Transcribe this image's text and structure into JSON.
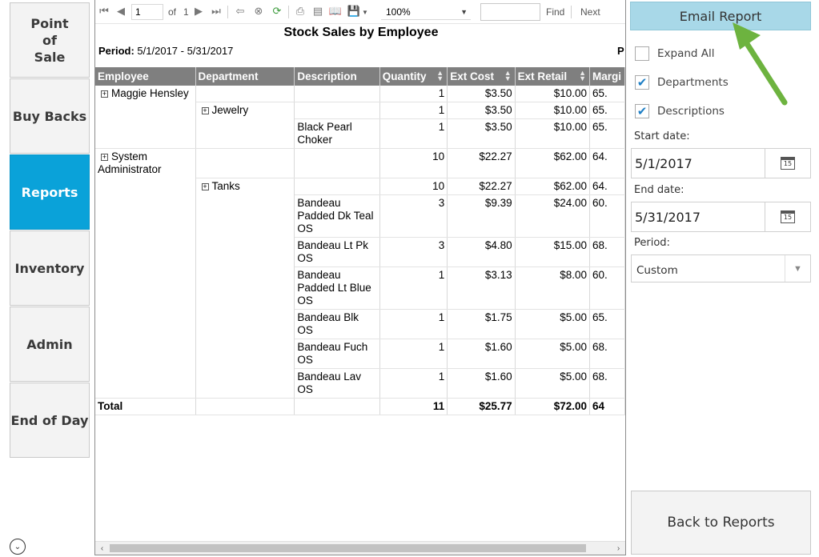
{
  "nav": {
    "items": [
      {
        "label": "Point\nof\nSale",
        "active": false
      },
      {
        "label": "Buy Backs",
        "active": false
      },
      {
        "label": "Reports",
        "active": true
      },
      {
        "label": "Inventory",
        "active": false
      },
      {
        "label": "Admin",
        "active": false
      },
      {
        "label": "End of Day",
        "active": false
      }
    ]
  },
  "toolbar": {
    "page_value": "1",
    "of_label": "of",
    "page_count": "1",
    "zoom": "100%",
    "find_label": "Find",
    "next_label": "Next"
  },
  "report": {
    "title": "Stock Sales by Employee",
    "period_label": "Period:",
    "period_value": "5/1/2017 - 5/31/2017",
    "cut_text": "P",
    "columns": [
      "Employee",
      "Department",
      "Description",
      "Quantity",
      "Ext Cost",
      "Ext Retail",
      "Margi"
    ],
    "rows": [
      {
        "employee": "Maggie Hensley",
        "department": "",
        "description": "",
        "quantity": "1",
        "ext_cost": "$3.50",
        "ext_retail": "$10.00",
        "margin": "65."
      },
      {
        "employee": "",
        "department": "Jewelry",
        "description": "",
        "quantity": "1",
        "ext_cost": "$3.50",
        "ext_retail": "$10.00",
        "margin": "65."
      },
      {
        "employee": "",
        "department": "",
        "description": "Black Pearl Choker",
        "quantity": "1",
        "ext_cost": "$3.50",
        "ext_retail": "$10.00",
        "margin": "65."
      },
      {
        "employee": "System Administrator",
        "department": "",
        "description": "",
        "quantity": "10",
        "ext_cost": "$22.27",
        "ext_retail": "$62.00",
        "margin": "64."
      },
      {
        "employee": "",
        "department": "Tanks",
        "description": "",
        "quantity": "10",
        "ext_cost": "$22.27",
        "ext_retail": "$62.00",
        "margin": "64."
      },
      {
        "employee": "",
        "department": "",
        "description": "Bandeau Padded Dk Teal OS",
        "quantity": "3",
        "ext_cost": "$9.39",
        "ext_retail": "$24.00",
        "margin": "60."
      },
      {
        "employee": "",
        "department": "",
        "description": "Bandeau Lt Pk OS",
        "quantity": "3",
        "ext_cost": "$4.80",
        "ext_retail": "$15.00",
        "margin": "68."
      },
      {
        "employee": "",
        "department": "",
        "description": "Bandeau Padded Lt Blue OS",
        "quantity": "1",
        "ext_cost": "$3.13",
        "ext_retail": "$8.00",
        "margin": "60."
      },
      {
        "employee": "",
        "department": "",
        "description": "Bandeau Blk OS",
        "quantity": "1",
        "ext_cost": "$1.75",
        "ext_retail": "$5.00",
        "margin": "65."
      },
      {
        "employee": "",
        "department": "",
        "description": "Bandeau Fuch OS",
        "quantity": "1",
        "ext_cost": "$1.60",
        "ext_retail": "$5.00",
        "margin": "68."
      },
      {
        "employee": "",
        "department": "",
        "description": "Bandeau Lav OS",
        "quantity": "1",
        "ext_cost": "$1.60",
        "ext_retail": "$5.00",
        "margin": "68."
      }
    ],
    "total": {
      "label": "Total",
      "quantity": "11",
      "ext_cost": "$25.77",
      "ext_retail": "$72.00",
      "margin": "64"
    }
  },
  "panel": {
    "email_label": "Email Report",
    "expand_all_label": "Expand All",
    "expand_all_checked": false,
    "departments_label": "Departments",
    "departments_checked": true,
    "descriptions_label": "Descriptions",
    "descriptions_checked": true,
    "start_date_label": "Start date:",
    "start_date_value": "5/1/2017",
    "end_date_label": "End date:",
    "end_date_value": "5/31/2017",
    "period_label": "Period:",
    "period_value": "Custom",
    "calendar_day": "15",
    "back_label": "Back to Reports"
  },
  "colors": {
    "active_nav": "#0aa2d9",
    "email_button": "#a8d8e8",
    "header_gray": "#7f7f7f",
    "annotation_arrow": "#6db33f"
  }
}
